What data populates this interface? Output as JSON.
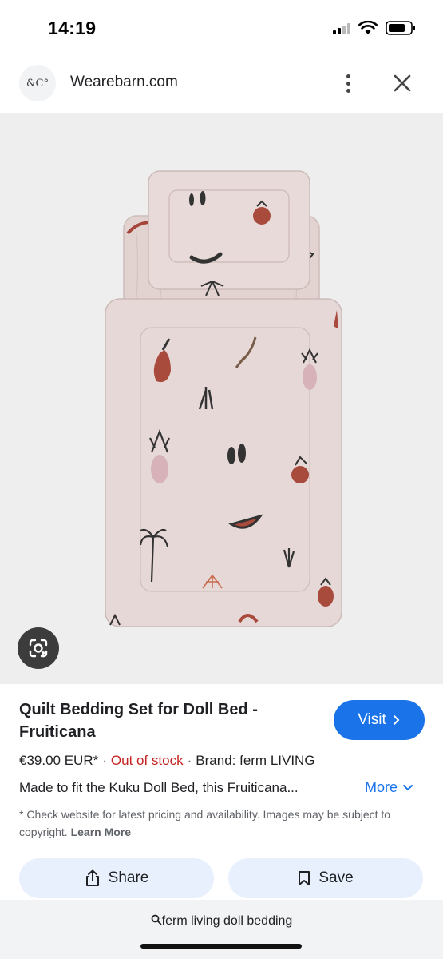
{
  "status_bar": {
    "time": "14:19"
  },
  "site": {
    "logo_text": "&C°",
    "name": "Wearebarn.com"
  },
  "product": {
    "title": "Quilt Bedding Set for Doll Bed - Fruiticana",
    "visit_label": "Visit",
    "price": "€39.00 EUR*",
    "stock": "Out of stock",
    "brand": "Brand: ferm LIVING",
    "description": "Made to fit the Kuku Doll Bed, this Fruiticana...",
    "more_label": "More",
    "disclaimer": "* Check website for latest pricing and availability. Images may be subject to copyright.",
    "learn_more": "Learn More"
  },
  "actions": {
    "share_label": "Share",
    "save_label": "Save"
  },
  "search": {
    "query": "ferm living doll bedding"
  },
  "colors": {
    "accent": "#1a73e8",
    "out_of_stock": "#c5221f",
    "button_bg": "#e8f0fe",
    "image_bg": "#eeeeee"
  }
}
